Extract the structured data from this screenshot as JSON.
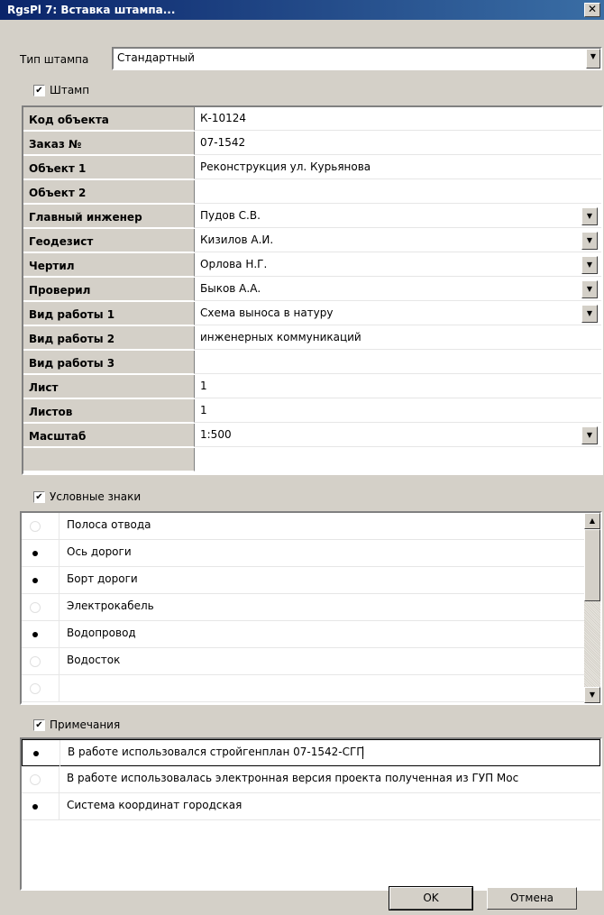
{
  "window": {
    "title": "RgsPl 7: Вставка штампа...",
    "close": "✕"
  },
  "stamp_type": {
    "label": "Тип штампа",
    "value": "Стандартный"
  },
  "stamp_check": {
    "label": "Штамп",
    "checked": true
  },
  "fields": [
    {
      "name": "Код объекта",
      "value": "К-10124",
      "dropdown": false
    },
    {
      "name": "Заказ №",
      "value": "07-1542",
      "dropdown": false
    },
    {
      "name": "Объект 1",
      "value": "Реконструкция ул. Курьянова",
      "dropdown": false
    },
    {
      "name": "Объект 2",
      "value": "",
      "dropdown": false
    },
    {
      "name": "Главный инженер",
      "value": "Пудов С.В.",
      "dropdown": true
    },
    {
      "name": "Геодезист",
      "value": "Кизилов А.И.",
      "dropdown": true
    },
    {
      "name": "Чертил",
      "value": "Орлова Н.Г.",
      "dropdown": true
    },
    {
      "name": "Проверил",
      "value": "Быков А.А.",
      "dropdown": true
    },
    {
      "name": "Вид работы 1",
      "value": "Схема выноса в натуру",
      "dropdown": true
    },
    {
      "name": "Вид работы 2",
      "value": "инженерных коммуникаций",
      "dropdown": false
    },
    {
      "name": "Вид работы 3",
      "value": "",
      "dropdown": false
    },
    {
      "name": "Лист",
      "value": "1",
      "dropdown": false
    },
    {
      "name": "Листов",
      "value": "1",
      "dropdown": false
    },
    {
      "name": "Масштаб",
      "value": "1:500",
      "dropdown": true
    }
  ],
  "symbols_check": {
    "label": "Условные знаки",
    "checked": true
  },
  "symbols": [
    {
      "label": "Полоса отвода",
      "selected": false
    },
    {
      "label": "Ось дороги",
      "selected": true
    },
    {
      "label": "Борт дороги",
      "selected": true
    },
    {
      "label": "Электрокабель",
      "selected": false
    },
    {
      "label": "Водопровод",
      "selected": true
    },
    {
      "label": "Водосток",
      "selected": false
    }
  ],
  "notes_check": {
    "label": "Примечания",
    "checked": true
  },
  "notes": [
    {
      "label": "В работе использовался стройгенплан 07-1542-СГП",
      "selected": true
    },
    {
      "label": "В работе использовалась электронная версия проекта полученная из ГУП Мос",
      "selected": false
    },
    {
      "label": "Система координат городская",
      "selected": true
    }
  ],
  "buttons": {
    "ok": "OK",
    "cancel": "Отмена"
  },
  "icons": {
    "check": "✔",
    "down": "▼",
    "up": "▲",
    "close": "close-icon"
  }
}
